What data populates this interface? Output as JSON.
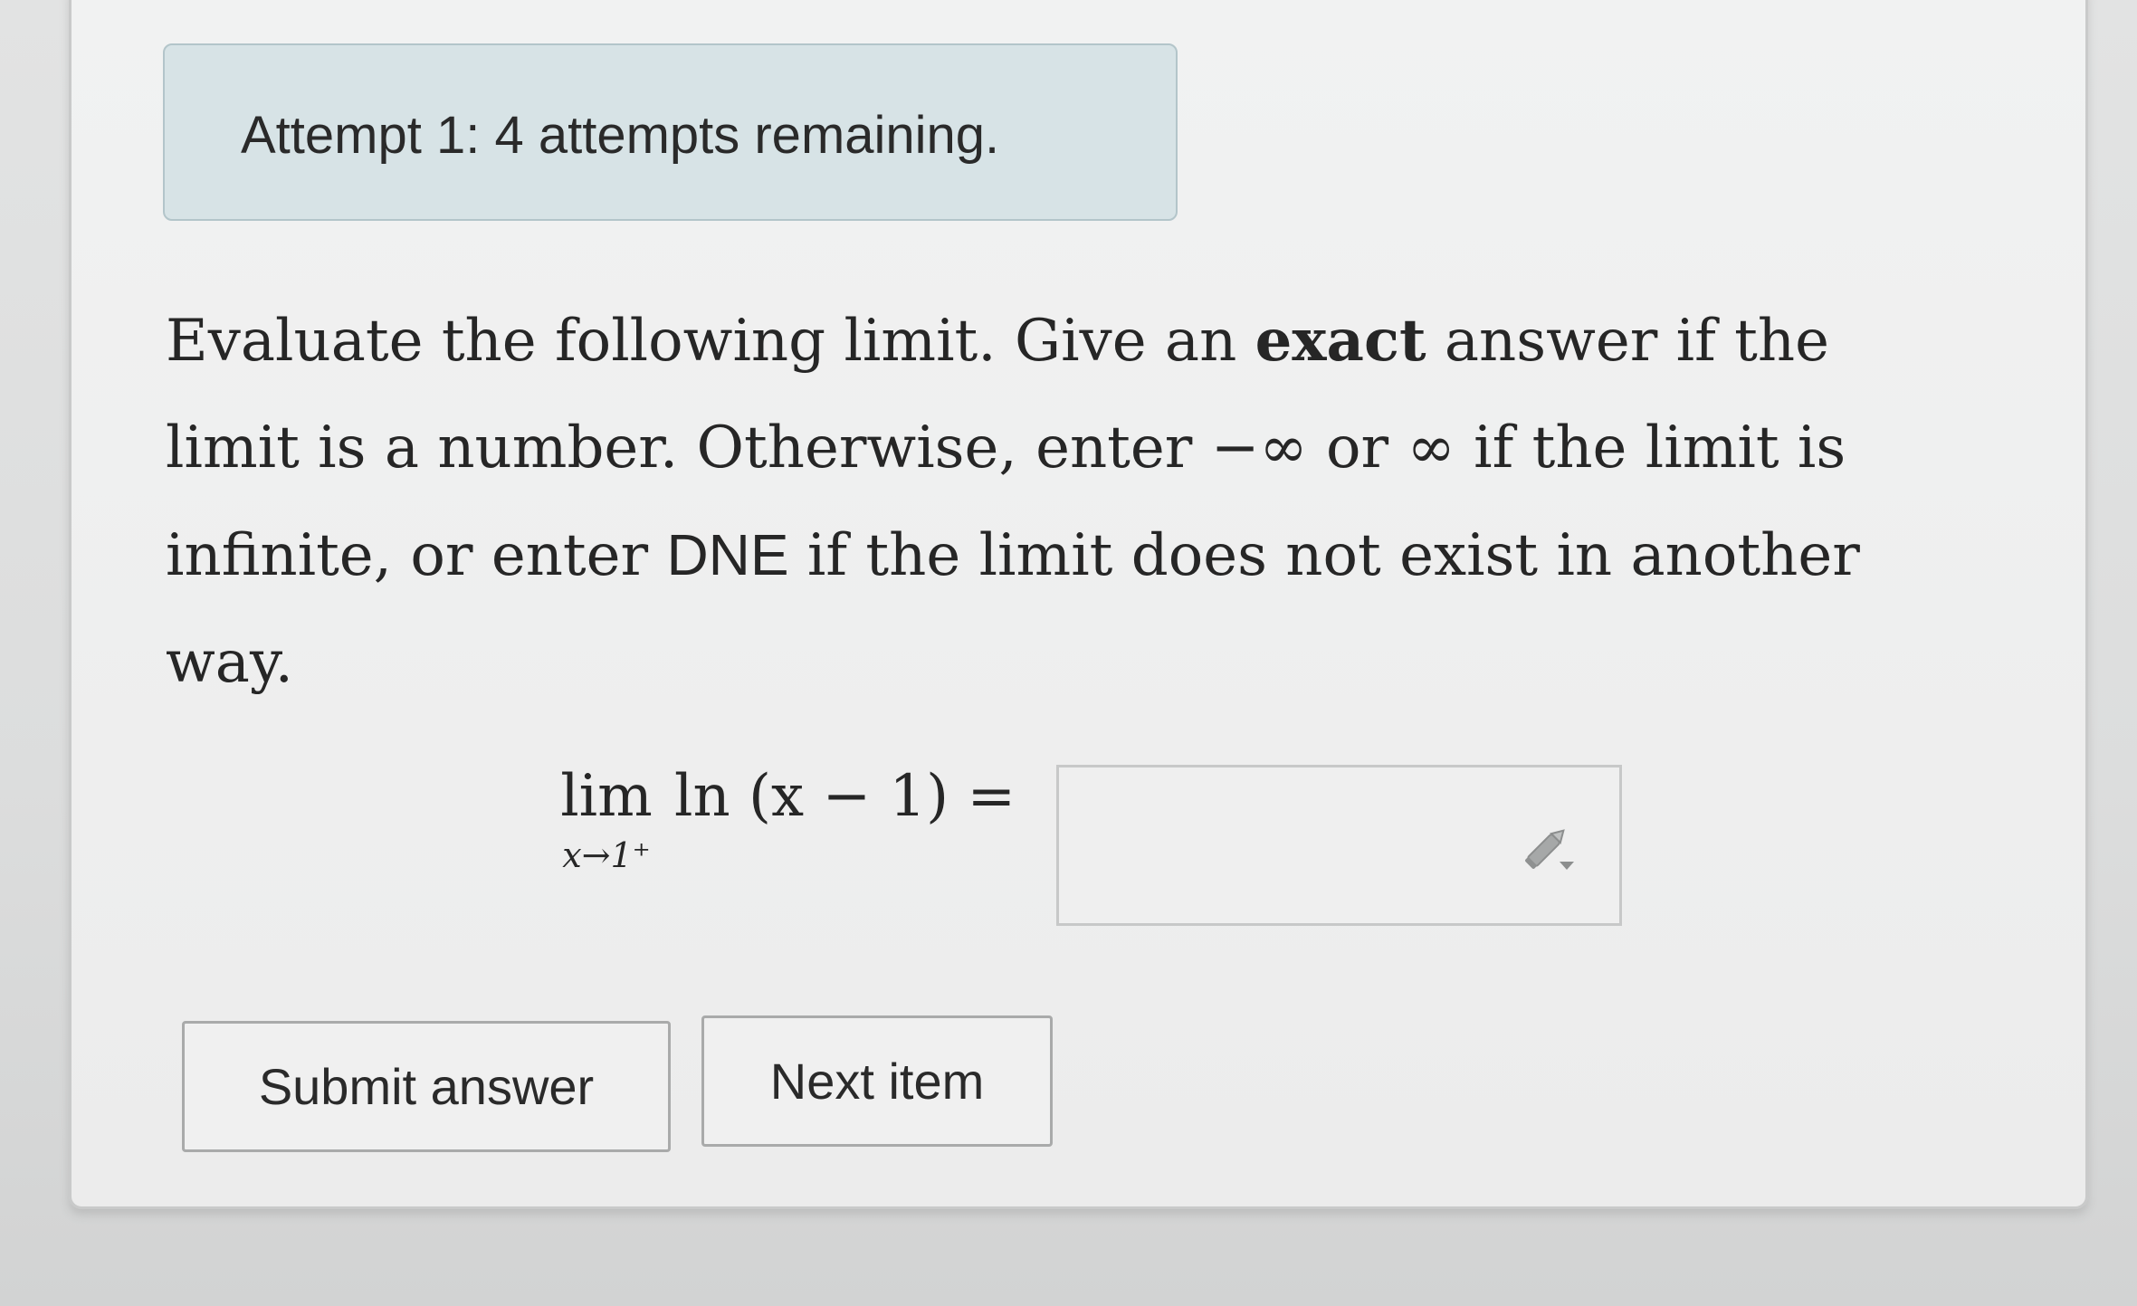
{
  "banner": {
    "attempt_text": "Attempt 1: 4 attempts remaining."
  },
  "question": {
    "part1": "Evaluate the following limit. Give an ",
    "bold_word": "exact",
    "part2": " answer if the limit is a number. Otherwise, enter −∞ or ∞ if the limit is infinite, or enter ",
    "dne_word": "DNE",
    "part3": " if the limit does not exist in another way."
  },
  "math": {
    "lim_word": "lim",
    "lim_subscript": "x→1⁺",
    "expression": "ln (x − 1) ="
  },
  "answer": {
    "value": "",
    "icon": "pencil-icon"
  },
  "buttons": {
    "submit_label": "Submit answer",
    "next_label": "Next item"
  }
}
